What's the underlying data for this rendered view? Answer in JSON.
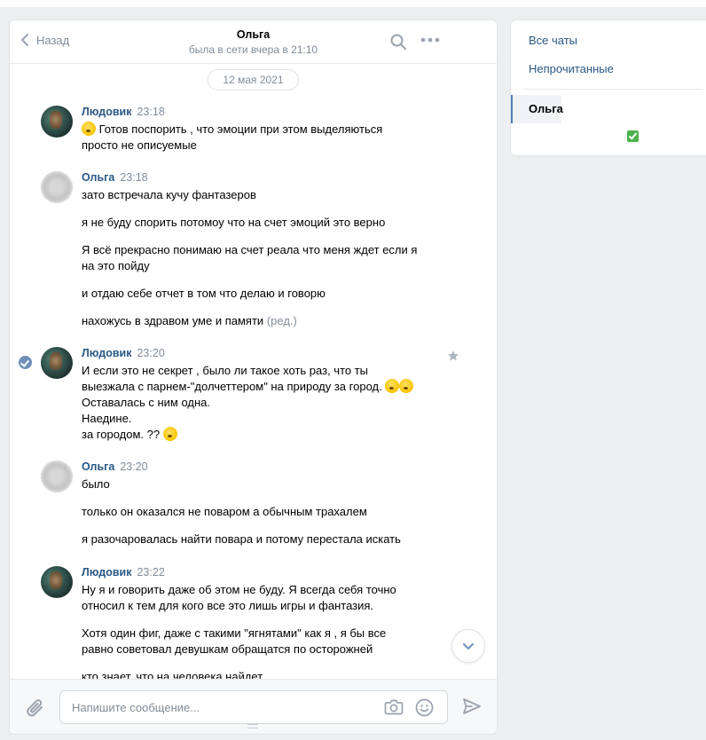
{
  "header": {
    "back_label": "Назад",
    "peer_name": "Ольга",
    "peer_status": "была в сети вчера в 21:10"
  },
  "history": {
    "date_label": "12 мая 2021",
    "messages": [
      {
        "author": "Людовик",
        "time": "23:18",
        "lines": [
          "Готов поспорить , что эмоции при этом выделяються",
          "просто не описуемые"
        ]
      },
      {
        "author": "Ольга",
        "time": "23:18",
        "lines": [
          "зато встречала кучу фантазеров",
          "я не буду спорить потомоу что на счет эмоций это верно",
          "Я всё прекрасно понимаю на счет реала что меня ждет если я",
          "на это пойду",
          "и отдаю себе отчет в том что делаю и говорю",
          "нахожусь в здравом уме и памяти"
        ],
        "edited_label": "(ред.)"
      },
      {
        "author": "Людовик",
        "time": "23:20",
        "lines": [
          "И если это не секрет , было ли такое хоть раз, что ты",
          "выезжала с парнем-\"долчеттером\" на природу за город.",
          "Оставалась с ним одна.",
          "Наедине.",
          "за городом. ??"
        ]
      },
      {
        "author": "Ольга",
        "time": "23:20",
        "lines": [
          "было",
          "только он оказался не поваром а обычным трахалем",
          "я разочаровалась найти повара и потому перестала искать"
        ]
      },
      {
        "author": "Людовик",
        "time": "23:22",
        "lines": [
          "Ну я и говорить даже об этом не буду. Я всегда себя точно",
          "относил к тем для кого все это лишь игры и фантазия.",
          "Хотя один фиг, даже с такими \"ягнятами\" как я , я бы все",
          "равно советовал девушкам обращатся по осторожней",
          "кто знает. что на человека найдет"
        ]
      }
    ]
  },
  "composer": {
    "placeholder": "Напишите сообщение..."
  },
  "folders": {
    "items": [
      "Все чаты",
      "Непрочитанные"
    ],
    "active_chat": "Ольга"
  },
  "colors": {
    "link": "#2a5885",
    "muted": "#818c99",
    "accent": "#5181b8",
    "background": "#edeef0"
  }
}
